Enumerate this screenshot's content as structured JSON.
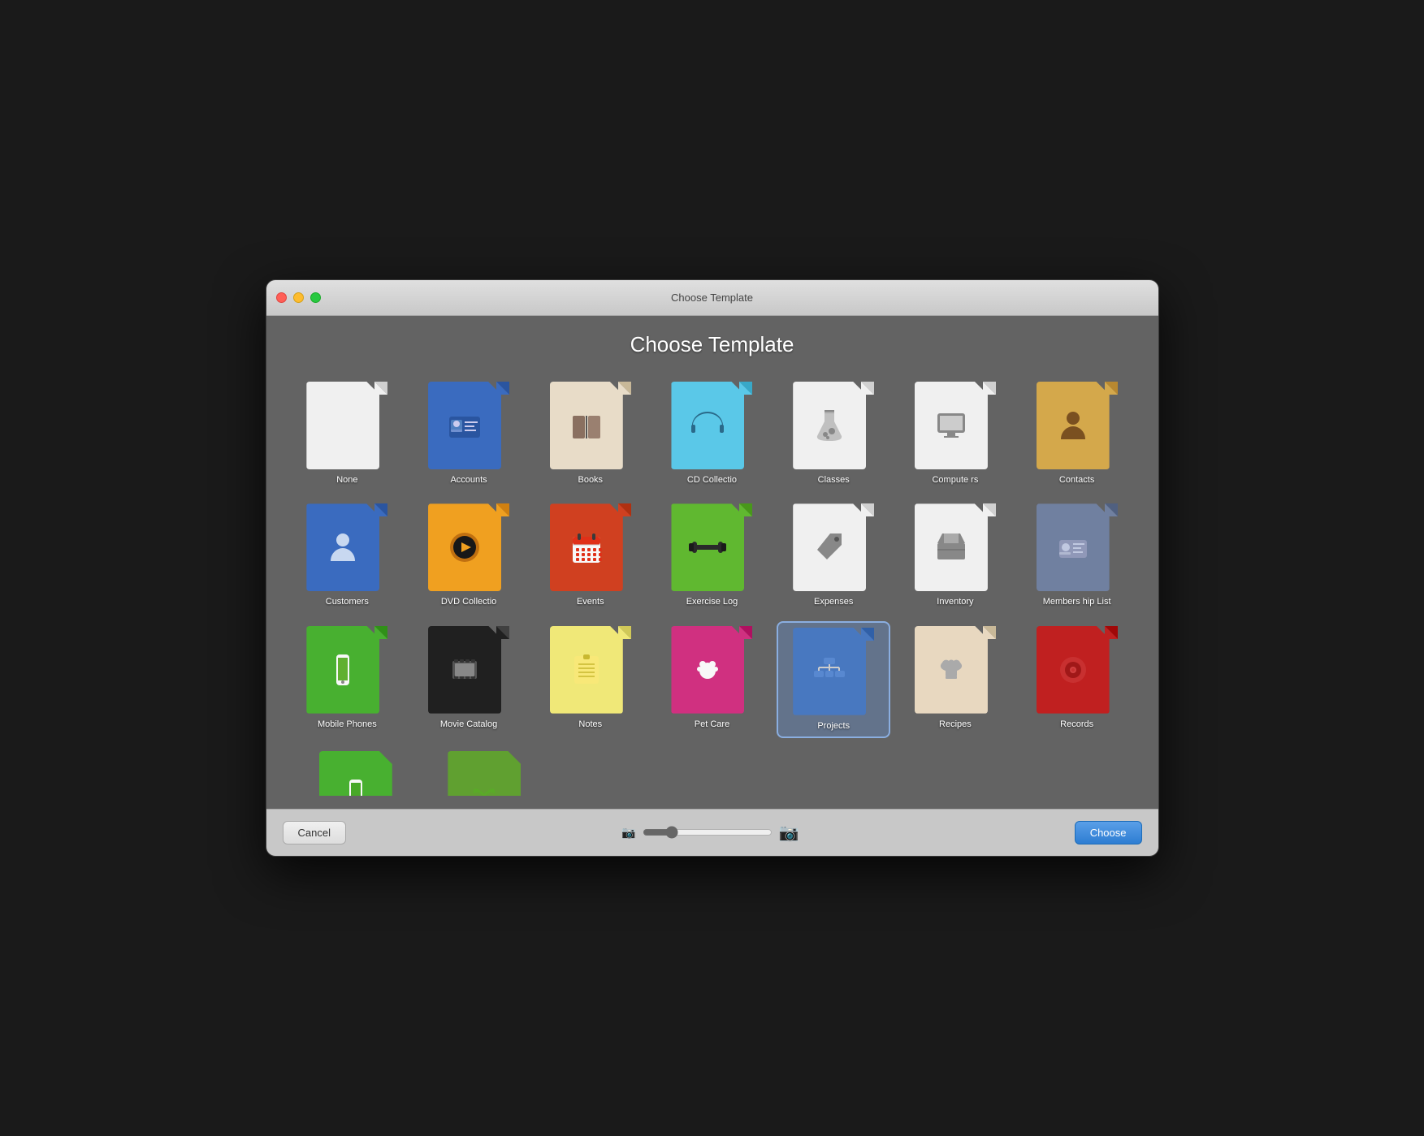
{
  "window": {
    "title": "Choose Template"
  },
  "main_title": "Choose Template",
  "templates": [
    {
      "id": "none",
      "label": "None",
      "bg": "#f0f0f0",
      "dog_ear_bg": "#d0d0d0",
      "icon": "none"
    },
    {
      "id": "accounts",
      "label": "Accounts",
      "bg": "#3a6bbf",
      "dog_ear_bg": "#2a55a0",
      "icon": "accounts"
    },
    {
      "id": "books",
      "label": "Books",
      "bg": "#e8dcc8",
      "dog_ear_bg": "#c8b898",
      "icon": "books"
    },
    {
      "id": "cd-collection",
      "label": "CD Collectio",
      "bg": "#5ac8e8",
      "dog_ear_bg": "#38a8c8",
      "icon": "cd"
    },
    {
      "id": "classes",
      "label": "Classes",
      "bg": "#f0f0f0",
      "dog_ear_bg": "#d0d0d0",
      "icon": "classes"
    },
    {
      "id": "computers",
      "label": "Compute rs",
      "bg": "#f0f0f0",
      "dog_ear_bg": "#d0d0d0",
      "icon": "computers"
    },
    {
      "id": "contacts",
      "label": "Contacts",
      "bg": "#d4a84b",
      "dog_ear_bg": "#b88830",
      "icon": "contacts"
    },
    {
      "id": "customers",
      "label": "Customers",
      "bg": "#3a6bbf",
      "dog_ear_bg": "#2a55a0",
      "icon": "customers"
    },
    {
      "id": "dvd-collection",
      "label": "DVD Collectio",
      "bg": "#f0a020",
      "dog_ear_bg": "#d08010",
      "icon": "dvd"
    },
    {
      "id": "events",
      "label": "Events",
      "bg": "#d04020",
      "dog_ear_bg": "#b03010",
      "icon": "events"
    },
    {
      "id": "exercise-log",
      "label": "Exercise Log",
      "bg": "#60b830",
      "dog_ear_bg": "#48981a",
      "icon": "exercise"
    },
    {
      "id": "expenses",
      "label": "Expenses",
      "bg": "#f0f0f0",
      "dog_ear_bg": "#d0d0d0",
      "icon": "expenses"
    },
    {
      "id": "inventory",
      "label": "Inventory",
      "bg": "#f0f0f0",
      "dog_ear_bg": "#d0d0d0",
      "icon": "inventory"
    },
    {
      "id": "membership-list",
      "label": "Members hip List",
      "bg": "#7080a0",
      "dog_ear_bg": "#506080",
      "icon": "membership"
    },
    {
      "id": "mobile-phones",
      "label": "Mobile Phones",
      "bg": "#48b030",
      "dog_ear_bg": "#309018",
      "icon": "mobile"
    },
    {
      "id": "movie-catalog",
      "label": "Movie Catalog",
      "bg": "#202020",
      "dog_ear_bg": "#404040",
      "icon": "movie"
    },
    {
      "id": "notes",
      "label": "Notes",
      "bg": "#f0e878",
      "dog_ear_bg": "#d0c858",
      "icon": "notes"
    },
    {
      "id": "pet-care",
      "label": "Pet Care",
      "bg": "#d03080",
      "dog_ear_bg": "#b01060",
      "icon": "petcare"
    },
    {
      "id": "projects",
      "label": "Projects",
      "bg": "#4878c0",
      "dog_ear_bg": "#3060a8",
      "icon": "projects",
      "selected": true
    },
    {
      "id": "recipes",
      "label": "Recipes",
      "bg": "#e8d8c0",
      "dog_ear_bg": "#c8b898",
      "icon": "recipes"
    },
    {
      "id": "records",
      "label": "Records",
      "bg": "#c02020",
      "dog_ear_bg": "#a00808",
      "icon": "records"
    }
  ],
  "partial_templates": [
    {
      "id": "partial1",
      "label": "",
      "bg": "#48b030",
      "dog_ear_bg": "#309018",
      "icon": "mobile2"
    },
    {
      "id": "partial2",
      "label": "",
      "bg": "#60a030",
      "dog_ear_bg": "#409010",
      "icon": "plant"
    }
  ],
  "buttons": {
    "cancel": "Cancel",
    "choose": "Choose"
  },
  "slider": {
    "value": 20,
    "min": 0,
    "max": 100
  }
}
